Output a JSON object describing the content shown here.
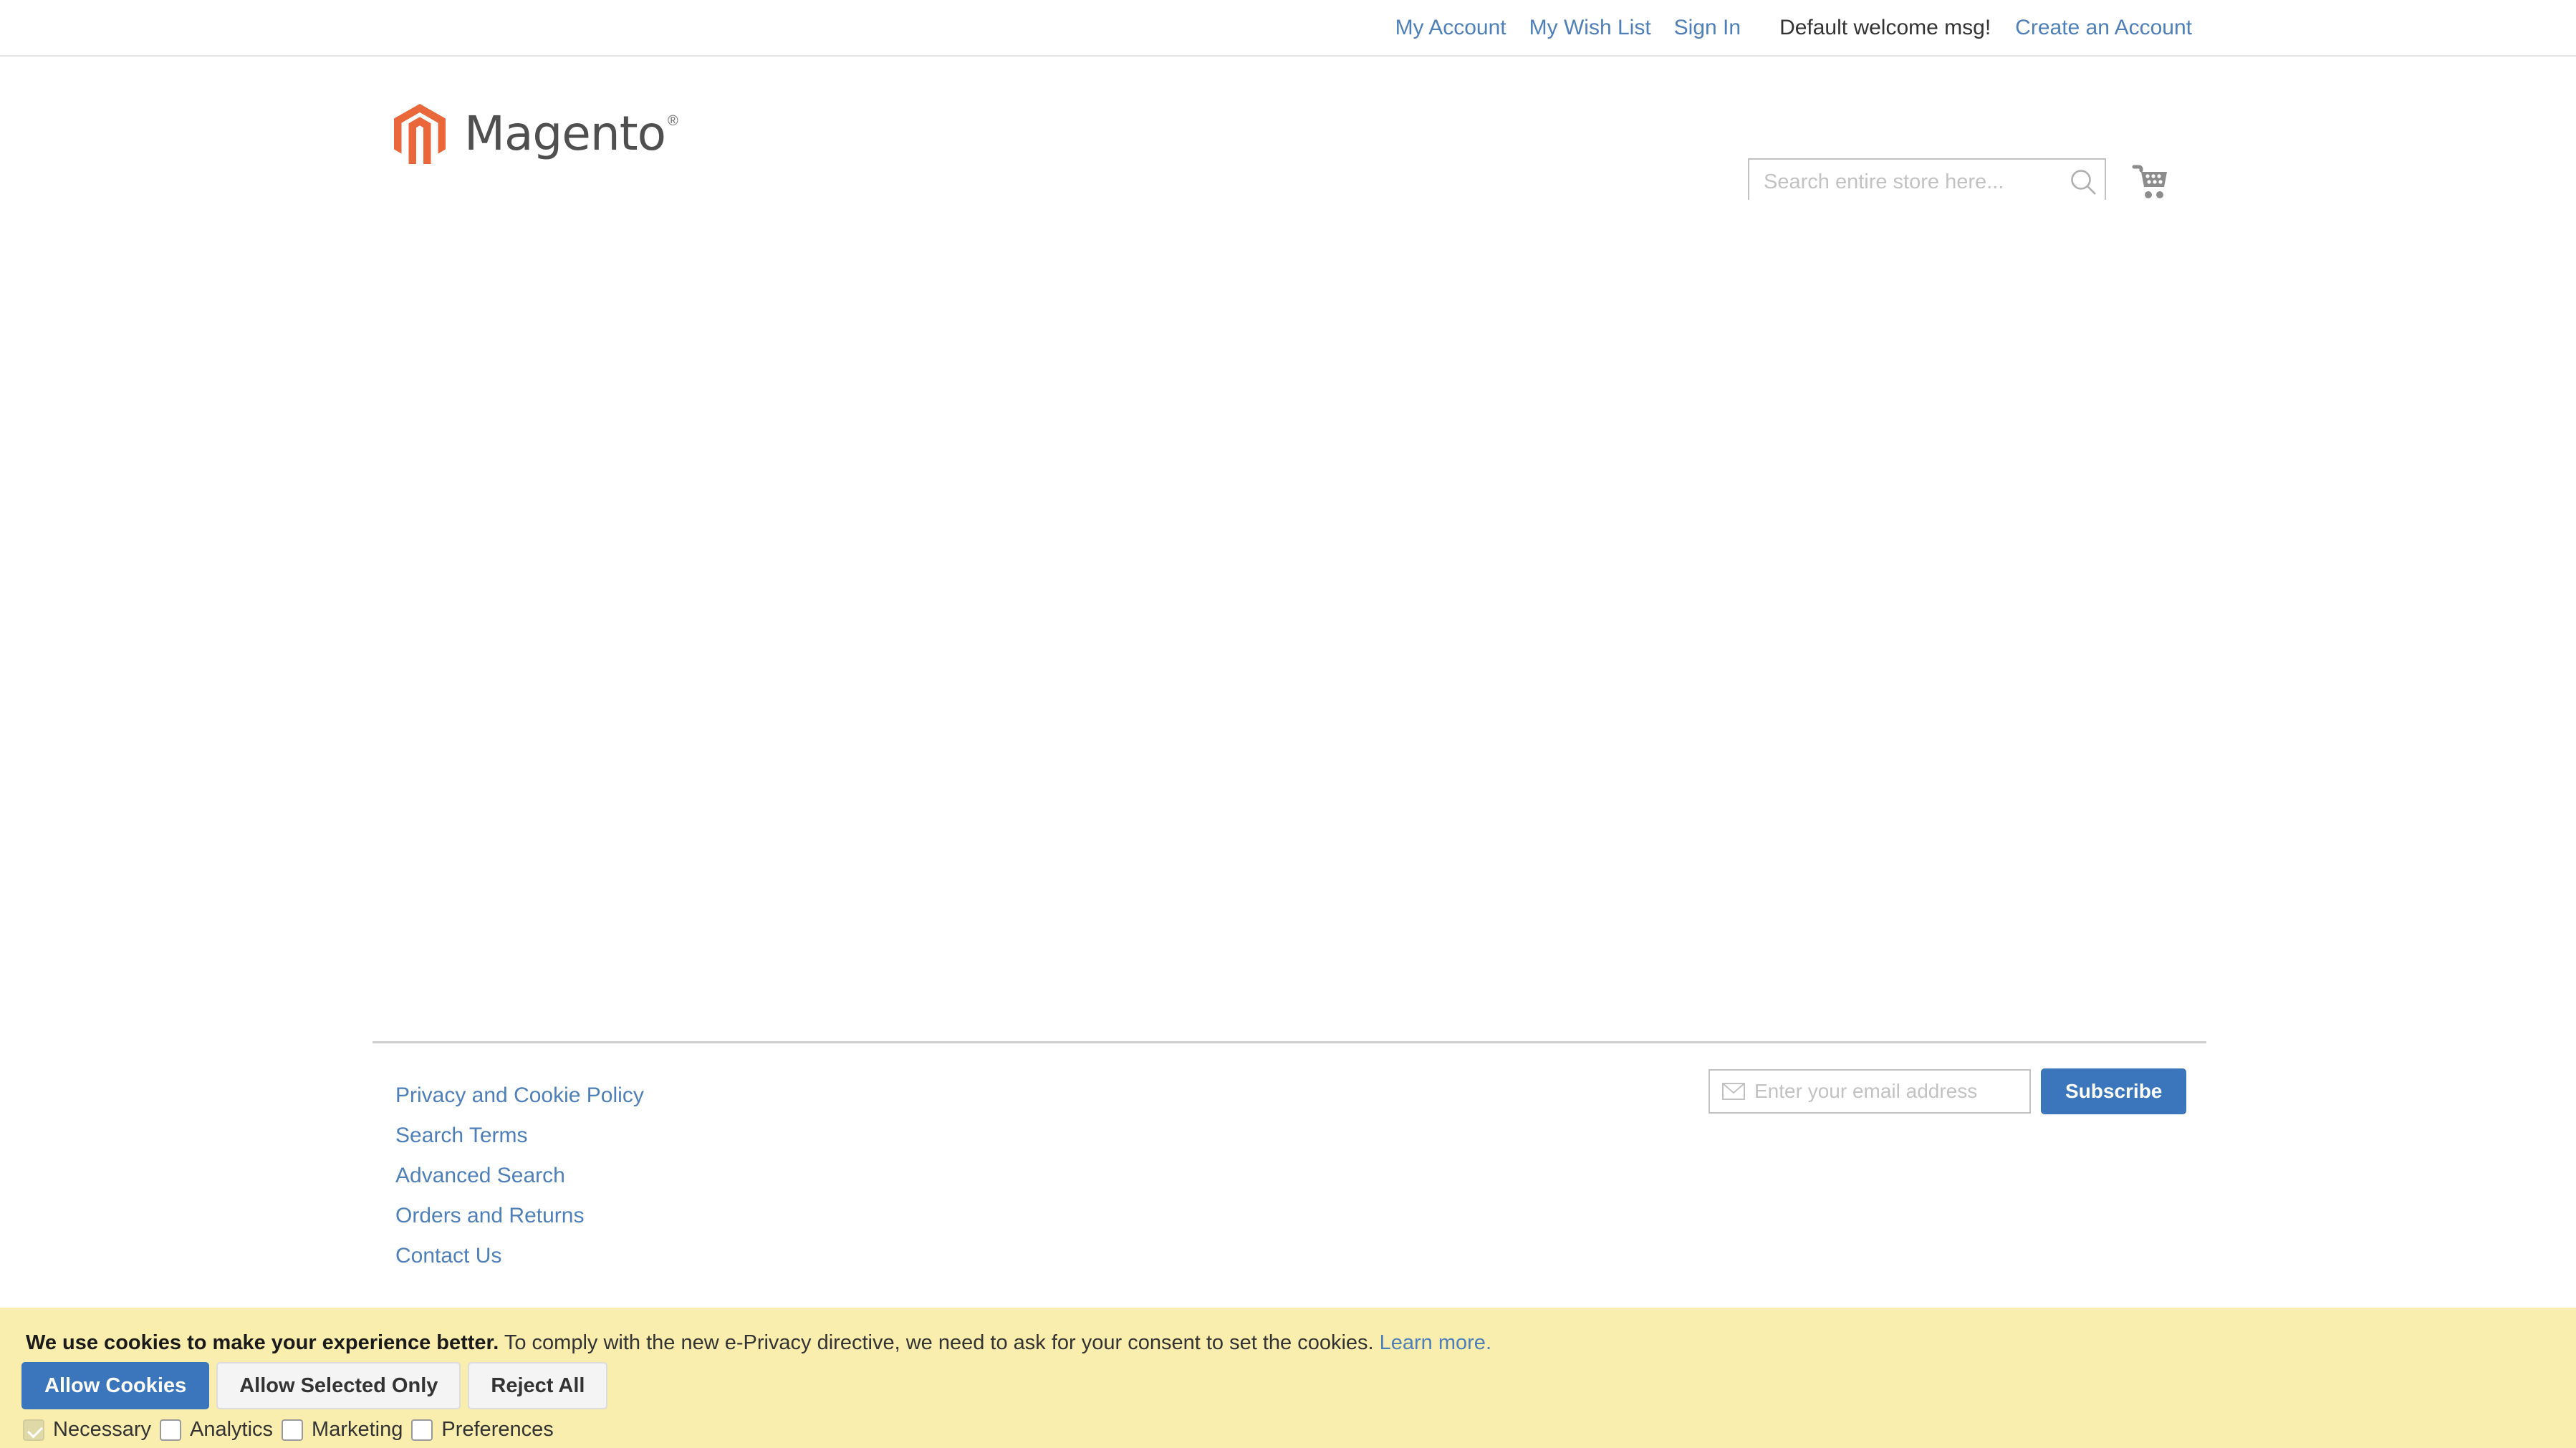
{
  "top_panel": {
    "links": [
      {
        "label": "My Account",
        "name": "my-account-link"
      },
      {
        "label": "My Wish List",
        "name": "my-wish-list-link"
      },
      {
        "label": "Sign In",
        "name": "sign-in-link"
      }
    ],
    "welcome_message": "Default welcome msg!",
    "create_account_label": "Create an Account"
  },
  "header": {
    "logo_text": "Magento",
    "logo_registered": "®",
    "logo_color": "#e9673a",
    "search": {
      "placeholder": "Search entire store here...",
      "value": "",
      "button_label": "Search"
    },
    "cart_label": "My Cart"
  },
  "footer": {
    "links": [
      {
        "label": "Privacy and Cookie Policy"
      },
      {
        "label": "Search Terms"
      },
      {
        "label": "Advanced Search"
      },
      {
        "label": "Orders and Returns"
      },
      {
        "label": "Contact Us"
      }
    ],
    "newsletter": {
      "placeholder": "Enter your email address",
      "value": "",
      "subscribe_label": "Subscribe"
    }
  },
  "cookie_banner": {
    "headline": "We use cookies to make your experience better.",
    "body": " To comply with the new e-Privacy directive, we need to ask for your consent to set the cookies. ",
    "learn_more_label": "Learn more.",
    "buttons": {
      "allow": "Allow Cookies",
      "allow_selected": "Allow Selected Only",
      "reject": "Reject All"
    },
    "categories": [
      {
        "label": "Necessary",
        "checked": true,
        "disabled": true
      },
      {
        "label": "Analytics",
        "checked": false,
        "disabled": false
      },
      {
        "label": "Marketing",
        "checked": false,
        "disabled": false
      },
      {
        "label": "Preferences",
        "checked": false,
        "disabled": false
      }
    ],
    "background_color": "#f9eeae",
    "accent_color": "#3b76bc"
  }
}
